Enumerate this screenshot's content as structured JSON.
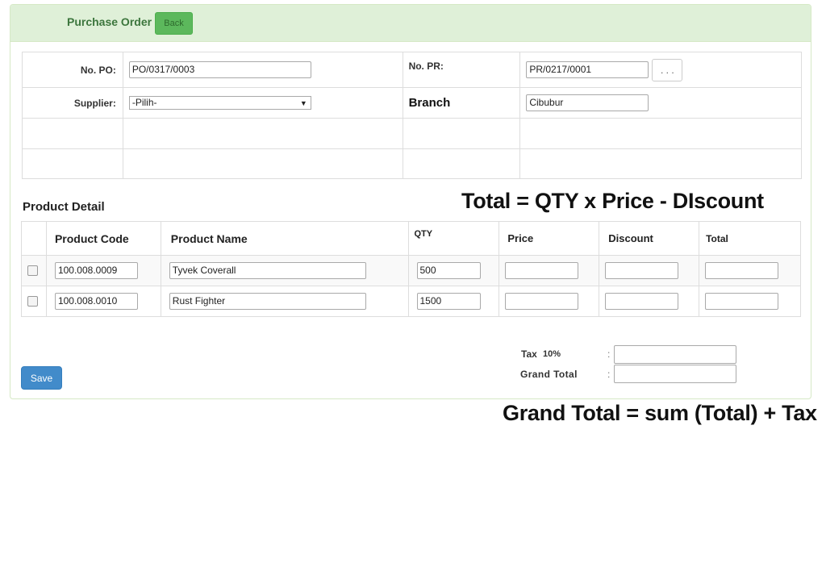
{
  "header": {
    "title": "Purchase Order",
    "back_label": "Back"
  },
  "form": {
    "po_label": "No. PO:",
    "po_value": "PO/0317/0003",
    "pr_label": "No. PR:",
    "pr_value": "PR/0217/0001",
    "browse_label": ". . .",
    "supplier_label": "Supplier:",
    "supplier_value": "-Pilih-",
    "branch_label": "Branch",
    "branch_value": "Cibubur"
  },
  "product_detail": {
    "title": "Product Detail",
    "columns": [
      "Product Code",
      "Product Name",
      "QTY",
      "Price",
      "Discount",
      "Total"
    ],
    "rows": [
      {
        "code": "100.008.0009",
        "name": "Tyvek Coverall",
        "qty": "500",
        "price": "",
        "discount": "",
        "total": ""
      },
      {
        "code": "100.008.0010",
        "name": "Rust Fighter",
        "qty": "1500",
        "price": "",
        "discount": "",
        "total": ""
      }
    ]
  },
  "summary": {
    "tax_label": "Tax",
    "tax_pct": "10%",
    "grand_total_label": "Grand Total",
    "colon": ":",
    "tax_value": "",
    "grand_total_value": ""
  },
  "actions": {
    "save_label": "Save"
  },
  "annotations": {
    "line_formula": "Total = QTY x Price - DIscount",
    "grand_formula": "Grand Total = sum (Total) + Tax"
  },
  "colors": {
    "panel_heading_bg": "#dff0d8",
    "title_green": "#3c763d",
    "back_button": "#5cb85c",
    "save_button": "#428bca"
  }
}
